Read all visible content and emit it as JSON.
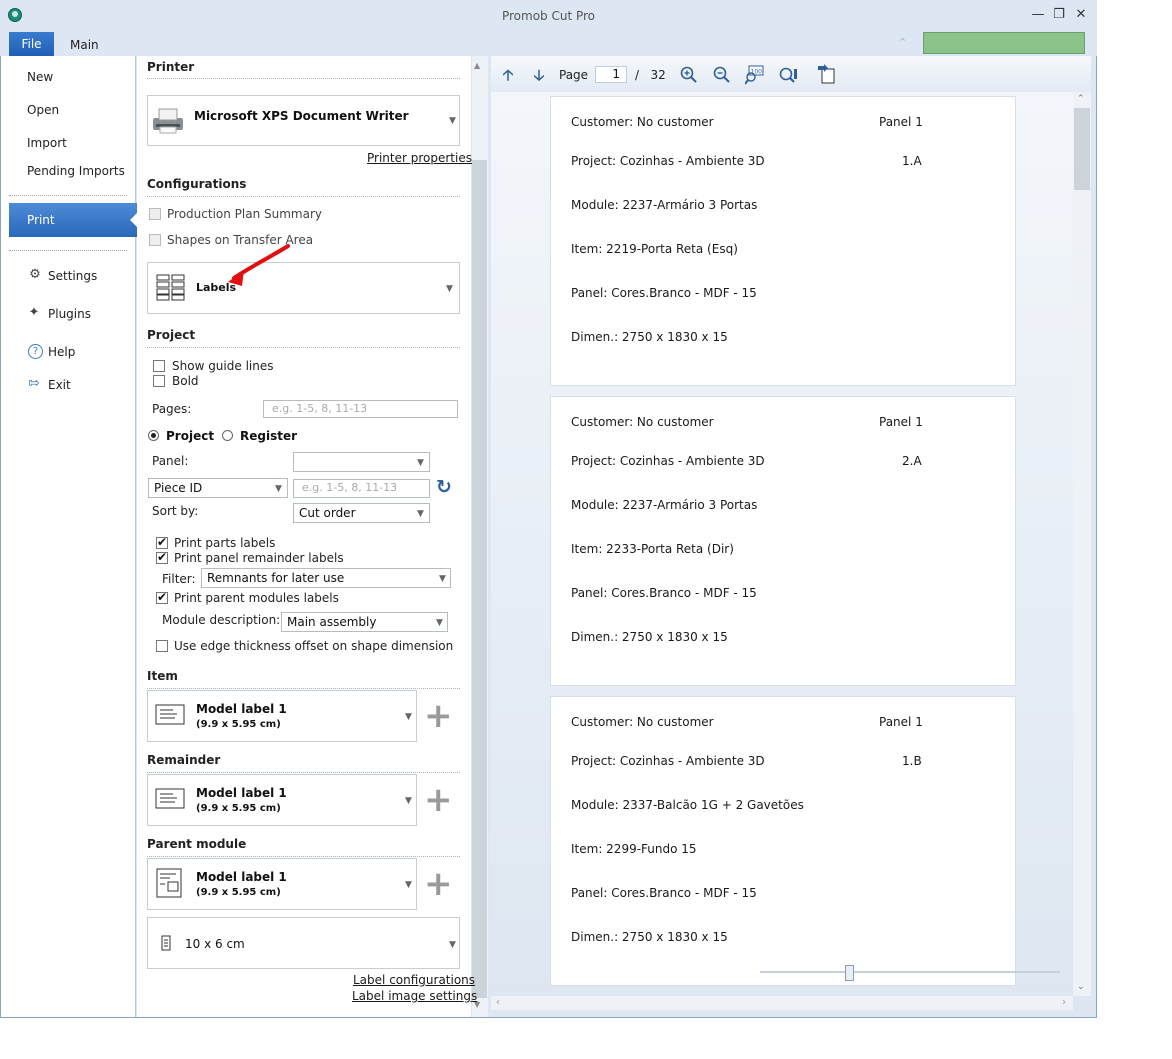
{
  "window": {
    "title": "Promob Cut Pro",
    "accent": "#2c67b9"
  },
  "menubar": {
    "file_label": "File",
    "main_label": "Main"
  },
  "nav": {
    "new": "New",
    "open": "Open",
    "import": "Import",
    "pending_imports": "Pending Imports",
    "print": "Print",
    "settings": "Settings",
    "plugins": "Plugins",
    "help": "Help",
    "exit": "Exit"
  },
  "printer": {
    "heading": "Printer",
    "selected": "Microsoft XPS Document Writer",
    "properties_link": "Printer properties"
  },
  "configurations": {
    "heading": "Configurations",
    "production_plan_summary": "Production Plan Summary",
    "shapes_on_transfer_area": "Shapes on Transfer Area",
    "mode": "Labels"
  },
  "project": {
    "heading": "Project",
    "show_guide_lines": "Show guide lines",
    "bold": "Bold",
    "pages_label": "Pages:",
    "pages_placeholder": "e.g. 1-5, 8, 11-13",
    "radio_project": "Project",
    "radio_register": "Register",
    "panel_label": "Panel:",
    "panel_value": "",
    "piece_id": "Piece ID",
    "piece_placeholder": "e.g. 1-5, 8, 11-13",
    "sort_by_label": "Sort by:",
    "sort_by_value": "Cut order",
    "print_parts_labels": "Print parts labels",
    "print_panel_remainder_labels": "Print panel remainder labels",
    "filter_label": "Filter:",
    "filter_value": "Remnants for later use",
    "print_parent_modules_labels": "Print parent modules labels",
    "module_description_label": "Module description:",
    "module_description_value": "Main assembly",
    "use_edge_thickness": "Use edge thickness offset on shape dimension"
  },
  "item": {
    "heading": "Item",
    "model": "Model label 1",
    "size": "(9.9 x 5.95 cm)"
  },
  "remainder": {
    "heading": "Remainder",
    "model": "Model label 1",
    "size": "(9.9 x 5.95 cm)"
  },
  "parent_module": {
    "heading": "Parent module",
    "model": "Model label 1",
    "size": "(9.9 x 5.95 cm)"
  },
  "page_size": {
    "value": "10 x 6 cm"
  },
  "links": {
    "label_configurations": "Label configurations",
    "label_image_settings": "Label image settings"
  },
  "preview": {
    "page_label": "Page",
    "current_page": "1",
    "separator": "/",
    "total_pages": "32",
    "labels": [
      {
        "customer": "Customer: No customer",
        "panel": "Panel 1",
        "project": "Project: Cozinhas - Ambiente 3D",
        "code": "1.A",
        "module": "Module: 2237-Armário 3 Portas",
        "item": "Item: 2219-Porta Reta (Esq)",
        "panel_desc": "Panel: Cores.Branco - MDF - 15",
        "dimen": "Dimen.: 2750 x 1830 x 15"
      },
      {
        "customer": "Customer: No customer",
        "panel": "Panel 1",
        "project": "Project: Cozinhas - Ambiente 3D",
        "code": "2.A",
        "module": "Module: 2237-Armário 3 Portas",
        "item": "Item: 2233-Porta Reta (Dir)",
        "panel_desc": "Panel: Cores.Branco - MDF - 15",
        "dimen": "Dimen.: 2750 x 1830 x 15"
      },
      {
        "customer": "Customer: No customer",
        "panel": "Panel 1",
        "project": "Project: Cozinhas - Ambiente 3D",
        "code": "1.B",
        "module": "Module: 2337-Balcão 1G + 2 Gavetões",
        "item": "Item: 2299-Fundo 15",
        "panel_desc": "Panel: Cores.Branco - MDF - 15",
        "dimen": "Dimen.: 2750 x 1830 x 15"
      }
    ]
  }
}
